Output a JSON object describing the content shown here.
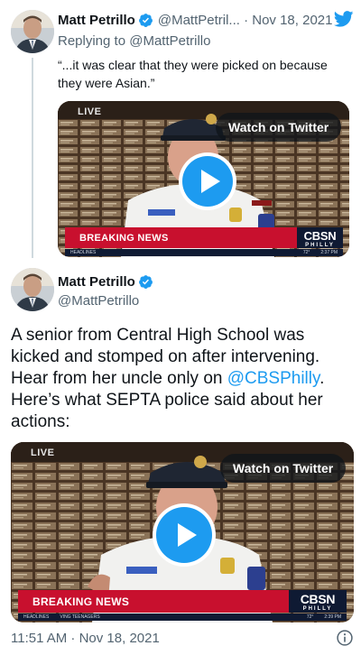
{
  "tweet1": {
    "author_name": "Matt Petrillo",
    "meta": "@MattPetril... · Nov 18, 2021",
    "replying_prefix": "Replying to ",
    "replying_handle": "@MattPetrillo",
    "text_line1": "“...it was clear that they were picked on because",
    "text_line2": "they were Asian.”",
    "video": {
      "live": "LIVE",
      "watch_label": "Watch on Twitter",
      "breaking": "BREAKING NEWS",
      "cbsn_big": "CBSN",
      "cbsn_small": "PHILLY",
      "ticker_temp": "72°",
      "ticker_time": "2:37 PM",
      "ticker_left": "HEADLINES"
    }
  },
  "tweet2": {
    "author_name": "Matt Petrillo",
    "handle": "@MattPetrillo",
    "text_line1": "A senior from Central High School was",
    "text_line2": "kicked and stomped on after intervening.",
    "text_line3_prefix": "Hear from her uncle only on ",
    "text_line3_mention": "@CBSPhilly",
    "text_line3_suffix": ".",
    "text_line4": "Here’s what SEPTA police said about her",
    "text_line5": "actions:",
    "video": {
      "live": "LIVE",
      "watch_label": "Watch on Twitter",
      "breaking": "BREAKING NEWS",
      "cbsn_big": "CBSN",
      "cbsn_small": "PHILLY",
      "ticker_left": "HEADLINES",
      "ticker_mid": "VING TEENAGERS",
      "ticker_temp": "72°",
      "ticker_time": "2:39 PM"
    },
    "timestamp": "11:51 AM · Nov 18, 2021"
  },
  "colors": {
    "accent": "#1d9bf0",
    "breaking_red": "#c8102e",
    "muted": "#536471",
    "thread_line": "#cfd9de"
  },
  "icons": {
    "logo": "twitter-bird-icon",
    "verified": "verified-badge-icon",
    "play": "play-icon",
    "info": "info-icon"
  }
}
